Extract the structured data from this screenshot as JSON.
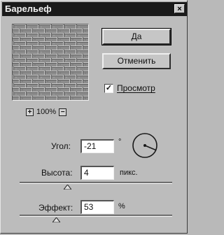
{
  "window": {
    "title": "Барельеф",
    "close_label": "×"
  },
  "preview": {
    "zoom_level": "100%",
    "zoom_in_label": "+",
    "zoom_out_label": "−"
  },
  "buttons": {
    "ok_label": "Да",
    "cancel_label": "Отменить"
  },
  "preview_checkbox": {
    "label": "Просмотр",
    "checked": true,
    "check_mark": "✓"
  },
  "angle": {
    "label": "Угол:",
    "value": "-21",
    "unit": "°"
  },
  "height": {
    "label": "Высота:",
    "value": "4",
    "unit": "пикс."
  },
  "effect": {
    "label": "Эффект:",
    "value": "53",
    "unit": "%"
  }
}
